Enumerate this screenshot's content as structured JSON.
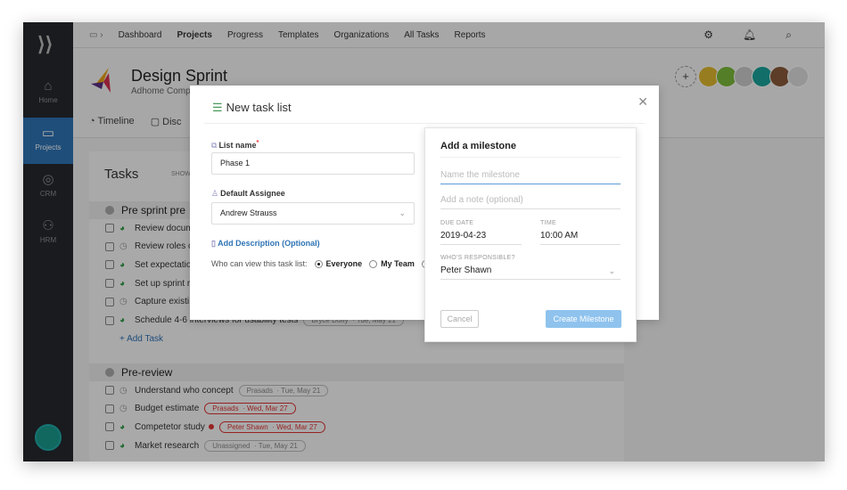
{
  "sidebar": {
    "items": [
      {
        "label": "Home",
        "icon": "home-icon"
      },
      {
        "label": "Projects",
        "icon": "projects-icon",
        "active": true
      },
      {
        "label": "CRM",
        "icon": "crm-icon"
      },
      {
        "label": "HRM",
        "icon": "hrm-icon"
      }
    ]
  },
  "nav": {
    "items": [
      "Dashboard",
      "Projects",
      "Progress",
      "Templates",
      "Organizations",
      "All Tasks",
      "Reports"
    ],
    "active": "Projects"
  },
  "project": {
    "title": "Design Sprint",
    "subtitle": "Adhome Comp",
    "tabs": [
      "Timeline",
      "Disc"
    ]
  },
  "tasks": {
    "title": "Tasks",
    "show": "SHOW",
    "add_task": "Add Task",
    "groups": [
      {
        "name": "Pre sprint pre",
        "rows": [
          {
            "name": "Review docum",
            "status": "green"
          },
          {
            "name": "Review roles o",
            "status": "gray"
          },
          {
            "name": "Set expectatio",
            "status": "green"
          },
          {
            "name": "Set up sprint r",
            "status": "green"
          },
          {
            "name": "Capture existi",
            "status": "gray"
          },
          {
            "name": "Schedule 4-6 interviews for usability tests",
            "status": "green",
            "assignee": "Bryce Duffy",
            "date": "Tue, May 21"
          }
        ]
      },
      {
        "name": "Pre-review",
        "rows": [
          {
            "name": "Understand who concept",
            "status": "gray",
            "assignee": "Prasads",
            "date": "Tue, May 21"
          },
          {
            "name": "Budget estimate",
            "status": "gray",
            "assignee": "Prasads",
            "date": "Wed, Mar 27",
            "overdue": true
          },
          {
            "name": "Competetor study",
            "status": "green",
            "assignee": "Peter Shawn",
            "date": "Wed, Mar 27",
            "overdue": true,
            "flag": true
          },
          {
            "name": "Market research",
            "status": "green",
            "assignee": "Unassigned",
            "date": "Tue, May 21"
          }
        ]
      }
    ]
  },
  "modal": {
    "title": "New task list",
    "list_name_label": "List name",
    "list_name_value": "Phase 1",
    "assignee_label": "Default Assignee",
    "assignee_value": "Andrew Strauss",
    "add_description": "Add Description (Optional)",
    "visibility_label": "Who can view this task list:",
    "visibility_options": [
      "Everyone",
      "My Team"
    ],
    "visibility_selected": "Everyone"
  },
  "milestone": {
    "title": "Add a milestone",
    "name_placeholder": "Name the milestone",
    "note_placeholder": "Add a note (optional)",
    "due_date_label": "DUE DATE",
    "due_date": "2019-04-23",
    "time_label": "TIME",
    "time": "10:00 AM",
    "responsible_label": "WHO'S RESPONSIBLE?",
    "responsible": "Peter Shawn",
    "cancel": "Cancel",
    "create": "Create Milestone"
  },
  "colors": {
    "accent": "#2f74b5",
    "sidebar": "#25282d",
    "overdue": "#dd3333",
    "create_button": "#8fc3ee"
  }
}
